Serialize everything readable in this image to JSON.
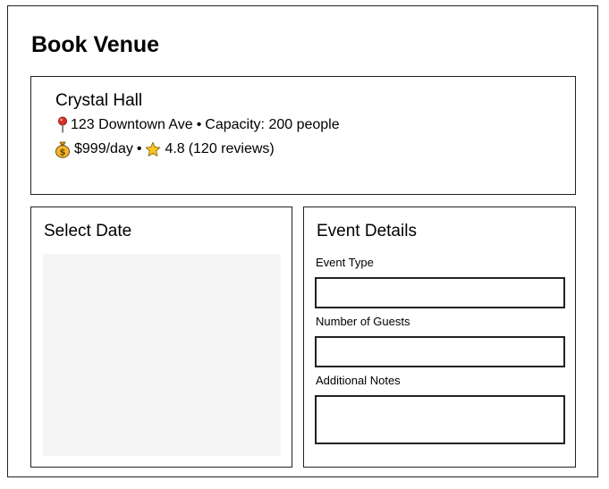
{
  "page": {
    "title": "Book Venue"
  },
  "venue": {
    "name": "Crystal Hall",
    "address": "123 Downtown Ave",
    "separator": "•",
    "capacity": "Capacity: 200 people",
    "price": "$999/day",
    "rating": "4.8",
    "reviews": "(120 reviews)",
    "icons": {
      "location": "pushpin-icon",
      "price": "money-bag-icon",
      "rating": "star-icon"
    },
    "colors": {
      "pin": "#d93025",
      "money_bag": "#f5b82e",
      "star": "#f9c623"
    }
  },
  "date_panel": {
    "title": "Select Date"
  },
  "details_panel": {
    "title": "Event Details",
    "fields": [
      {
        "label": "Event Type",
        "value": "",
        "placeholder": ""
      },
      {
        "label": "Number of Guests",
        "value": "",
        "placeholder": ""
      },
      {
        "label": "Additional Notes",
        "value": "",
        "placeholder": ""
      }
    ]
  }
}
